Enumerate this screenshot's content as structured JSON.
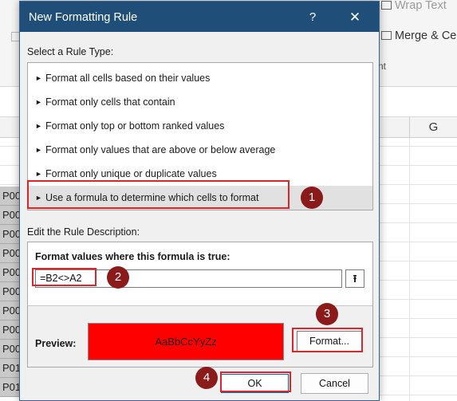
{
  "dialog": {
    "title": "New Formatting Rule",
    "help_glyph": "?",
    "close_glyph": "✕"
  },
  "rule_type": {
    "heading": "Select a Rule Type:",
    "items": [
      {
        "label": "Format all cells based on their values"
      },
      {
        "label": "Format only cells that contain"
      },
      {
        "label": "Format only top or bottom ranked values"
      },
      {
        "label": "Format only values that are above or below average"
      },
      {
        "label": "Format only unique or duplicate values"
      },
      {
        "label": "Use a formula to determine which cells to format",
        "selected": true
      }
    ],
    "bullet_glyph": "►"
  },
  "rule_description": {
    "heading": "Edit the Rule Description:",
    "formula_label": "Format values where this formula is true:",
    "formula_value": "=B2<>A2",
    "collapse_glyph": "⭱",
    "preview_label": "Preview:",
    "preview_sample": "AaBbCcYyZz",
    "preview_fill_color": "#ff0000",
    "format_button": "Format..."
  },
  "buttons": {
    "ok": "OK",
    "cancel": "Cancel"
  },
  "steps": [
    "1",
    "2",
    "3",
    "4"
  ],
  "annotation_color": "#d9262d",
  "step_badge_color": "#8b1a1a",
  "background": {
    "ribbon_wrap_text": "Wrap Text",
    "ribbon_merge": "Merge & Ce",
    "ribbon_group_tail": "nt",
    "column_g": "G",
    "row_labels": [
      "P00",
      "P00",
      "P00",
      "P00",
      "P00",
      "P00",
      "P00",
      "P00",
      "P00",
      "P01",
      "P01"
    ]
  }
}
